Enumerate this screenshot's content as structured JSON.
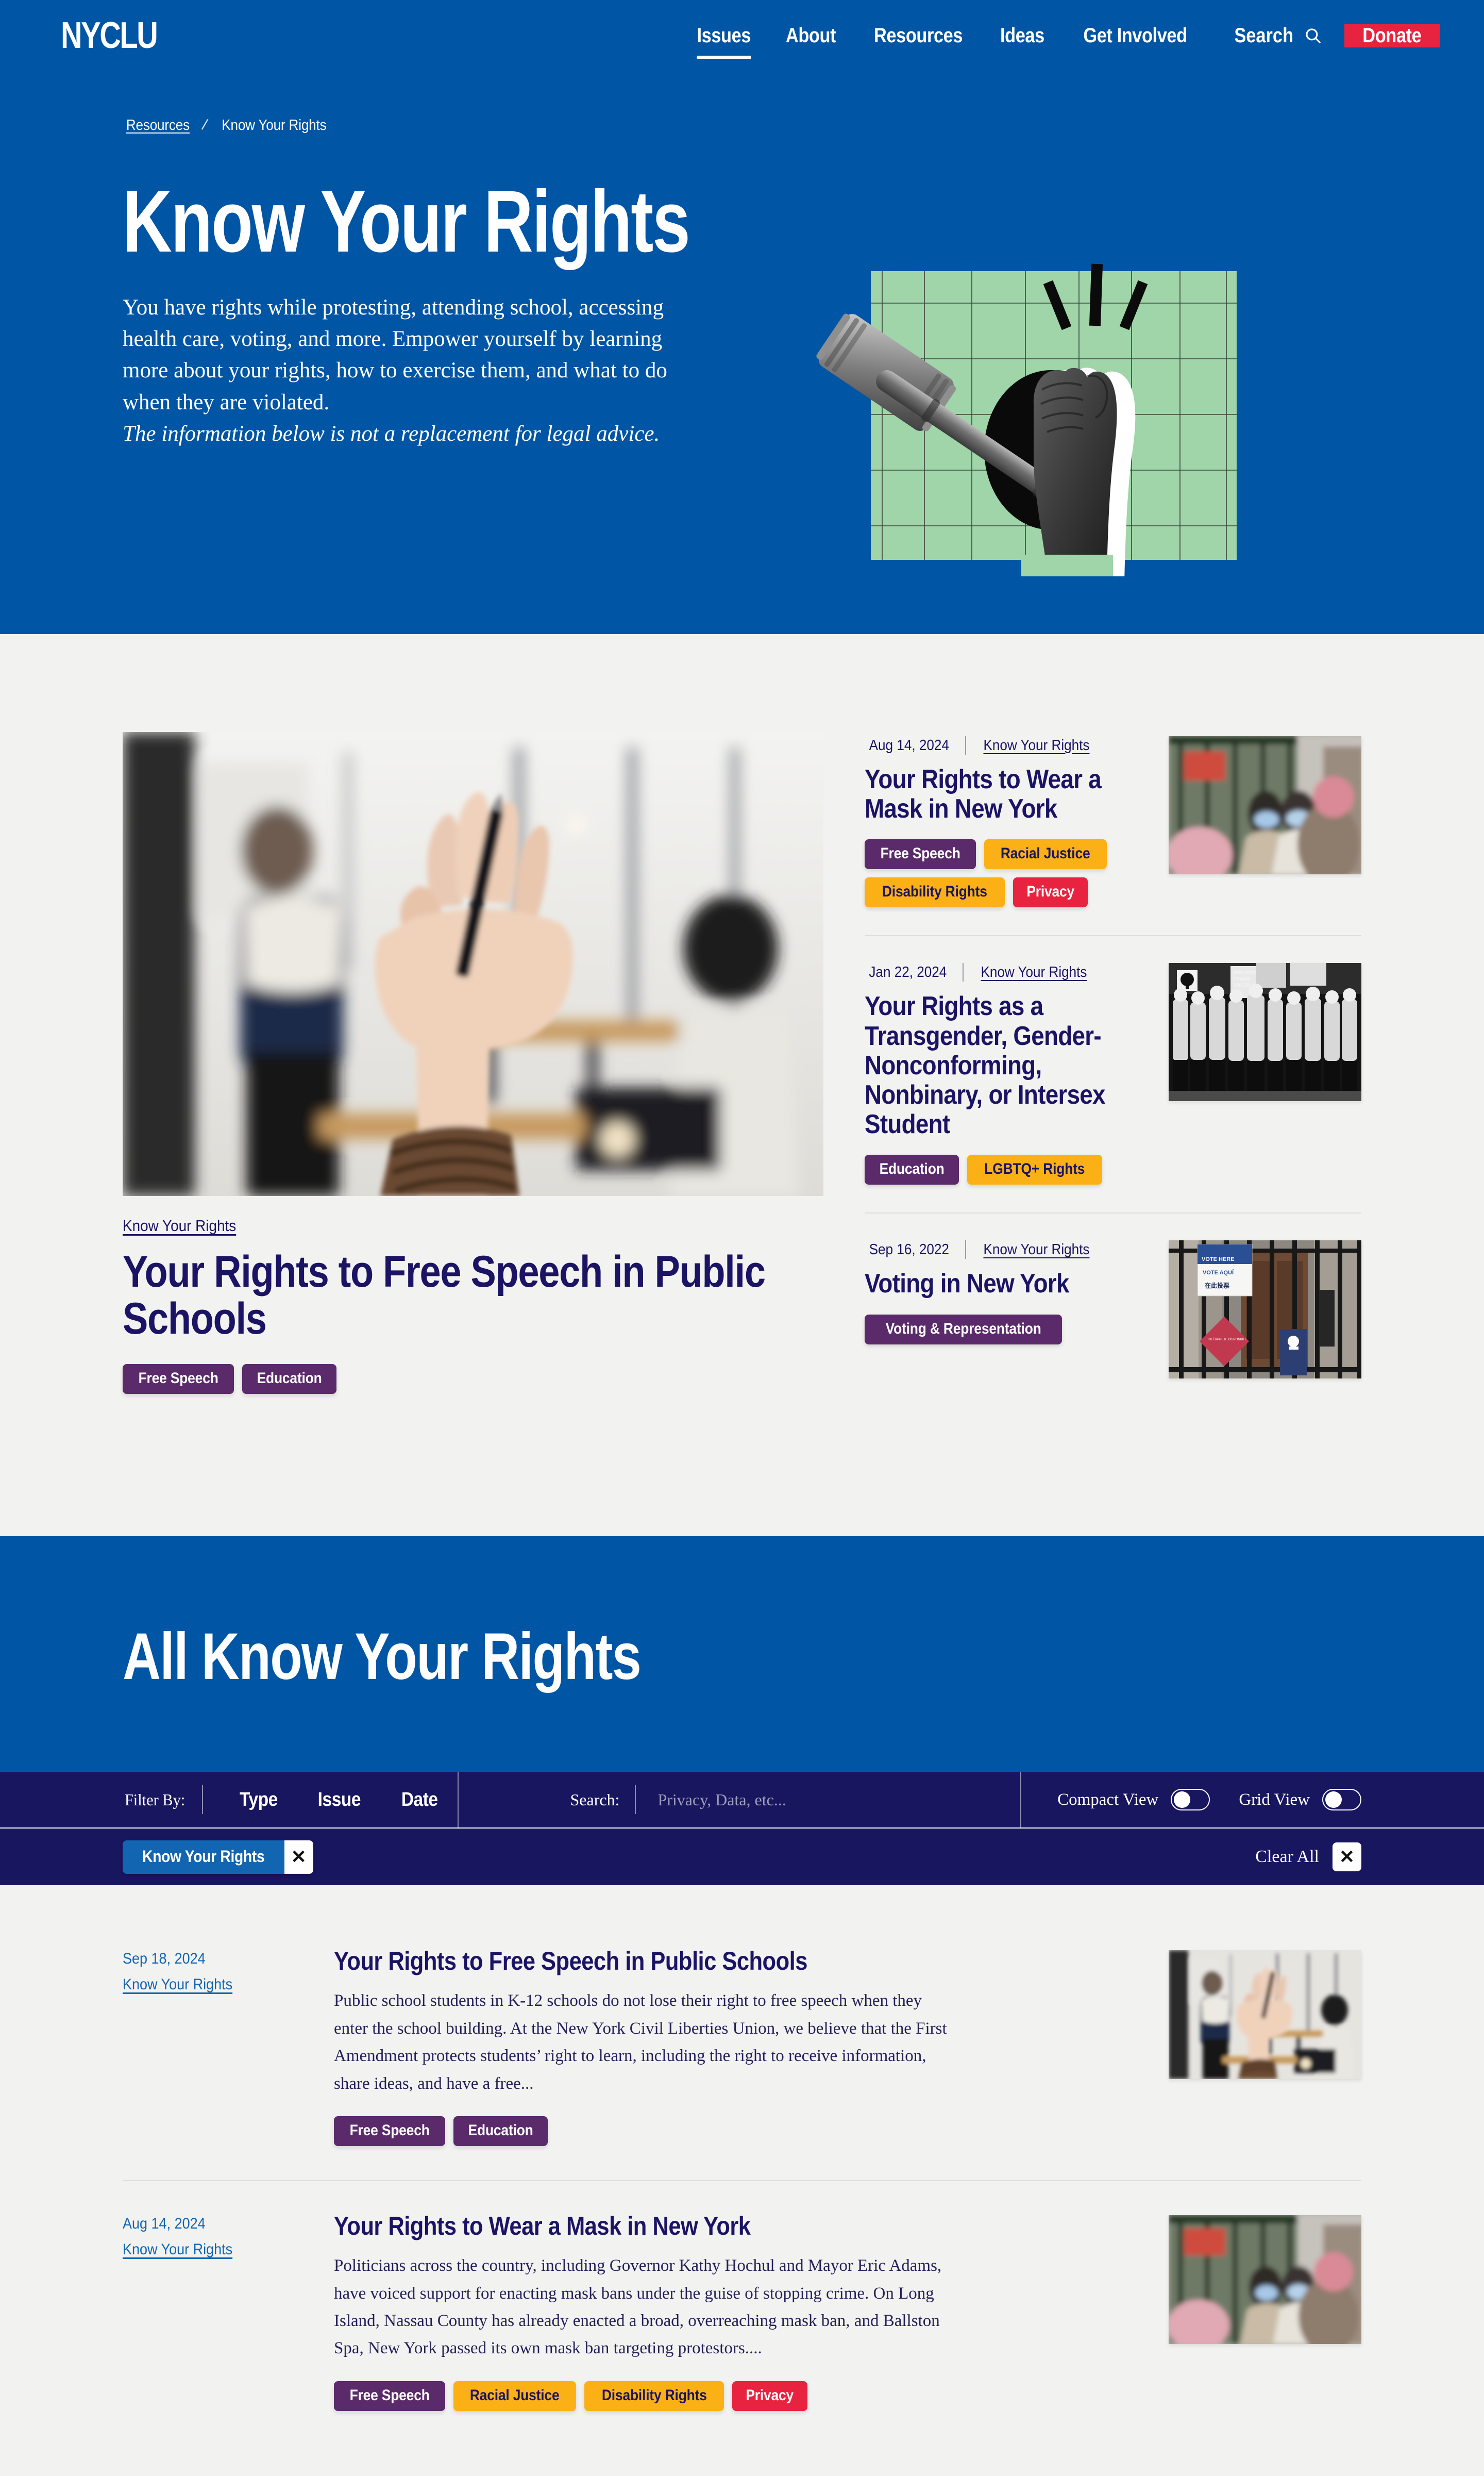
{
  "header": {
    "logo": "NYCLU",
    "nav": [
      {
        "label": "Issues",
        "active": true
      },
      {
        "label": "About",
        "active": false
      },
      {
        "label": "Resources",
        "active": false
      },
      {
        "label": "Ideas",
        "active": false
      },
      {
        "label": "Get Involved",
        "active": false
      }
    ],
    "search_label": "Search",
    "search_icon": "magnifier-icon",
    "donate_label": "Donate",
    "brand_blue": "#0055A5",
    "donate_red": "#E8233F"
  },
  "hero": {
    "breadcrumb": {
      "parent": "Resources",
      "separator": "/",
      "current": "Know Your Rights"
    },
    "title": "Know Your Rights",
    "body": "You have rights while protesting, attending school, accessing health care, voting, and more. Empower yourself by learning more about your rights, how to exercise them, and what to do when they are violated.",
    "disclaimer": "The information below is not a replacement for legal advice.",
    "illustration": "gavel-and-raised-fist-collage"
  },
  "featured": {
    "main": {
      "image": "students-raising-hands-in-classroom",
      "eyebrow": "Know Your Rights",
      "title": "Your Rights to Free Speech in Public Schools",
      "tags": [
        {
          "label": "Free Speech",
          "color": "purple"
        },
        {
          "label": "Education",
          "color": "purple"
        }
      ]
    },
    "side": [
      {
        "date": "Aug 14, 2024",
        "category": "Know Your Rights",
        "title": "Your Rights to Wear a Mask in New York",
        "image": "pedestrians-wearing-masks-on-city-street",
        "tags": [
          {
            "label": "Free Speech",
            "color": "purple"
          },
          {
            "label": "Racial Justice",
            "color": "yellow"
          },
          {
            "label": "Disability Rights",
            "color": "yellow"
          },
          {
            "label": "Privacy",
            "color": "red"
          }
        ]
      },
      {
        "date": "Jan 22, 2024",
        "category": "Know Your Rights",
        "title": "Your Rights as a Transgender, Gender-Nonconforming, Nonbinary, or Intersex Student",
        "image": "protest-crowd-holding-protect-trans-youth-signs",
        "tags": [
          {
            "label": "Education",
            "color": "purple"
          },
          {
            "label": "LGBTQ+ Rights",
            "color": "yellow"
          }
        ]
      },
      {
        "date": "Sep 16, 2022",
        "category": "Know Your Rights",
        "title": "Voting in New York",
        "image": "vote-here-vote-aqui-polling-place-sign",
        "tags": [
          {
            "label": "Voting & Representation",
            "color": "purple"
          }
        ]
      }
    ]
  },
  "all_section": {
    "title": "All Know Your Rights",
    "filter_bar": {
      "filter_by_label": "Filter By:",
      "filters": [
        "Type",
        "Issue",
        "Date"
      ],
      "search_label": "Search:",
      "search_value": "",
      "search_placeholder": "Privacy, Data, etc...",
      "toggles": [
        {
          "label": "Compact View",
          "on": false
        },
        {
          "label": "Grid View",
          "on": false
        }
      ]
    },
    "active_chips": [
      {
        "label": "Know Your Rights",
        "remove_icon": "close-icon"
      }
    ],
    "clear_all_label": "Clear All",
    "clear_all_icon": "close-icon"
  },
  "results": [
    {
      "date": "Sep 18, 2024",
      "category": "Know Your Rights",
      "title": "Your Rights to Free Speech in Public Schools",
      "description": "Public school students in K-12 schools do not lose their right to free speech when they enter the school building. At the New York Civil Liberties Union, we believe that the First Amendment protects students’ right to learn, including the right to receive information, share ideas, and have a free...",
      "image": "students-raising-hands-in-classroom",
      "tags": [
        {
          "label": "Free Speech",
          "color": "purple"
        },
        {
          "label": "Education",
          "color": "purple"
        }
      ]
    },
    {
      "date": "Aug 14, 2024",
      "category": "Know Your Rights",
      "title": "Your Rights to Wear a Mask in New York",
      "description": "Politicians across the country, including Governor Kathy Hochul and Mayor Eric Adams, have voiced support for enacting mask bans under the guise of stopping crime. On Long Island, Nassau County has already enacted a broad, overreaching mask ban, and Ballston Spa, New York passed its own mask ban targeting protestors....",
      "image": "pedestrians-wearing-masks-on-city-street",
      "tags": [
        {
          "label": "Free Speech",
          "color": "purple"
        },
        {
          "label": "Racial Justice",
          "color": "yellow"
        },
        {
          "label": "Disability Rights",
          "color": "yellow"
        },
        {
          "label": "Privacy",
          "color": "red"
        }
      ]
    }
  ],
  "colors": {
    "brand_blue": "#0055A5",
    "deep_navy": "#191660",
    "ink": "#1B1464",
    "page_bg": "#F2F2F0",
    "purple": "#5B2A6B",
    "yellow": "#FBB116",
    "red": "#E8233F",
    "link_blue": "#1265B0",
    "mint": "#9FD5A8"
  }
}
